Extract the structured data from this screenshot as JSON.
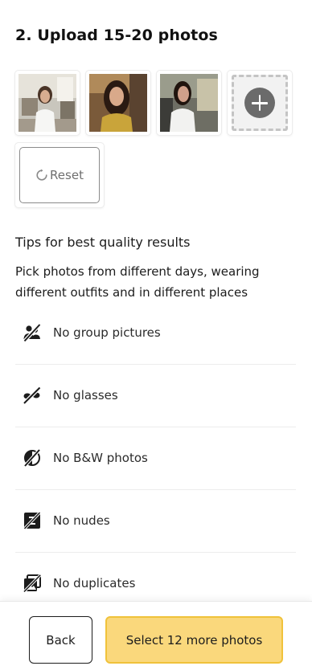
{
  "step": {
    "title": "2. Upload 15-20 photos"
  },
  "photos": [
    {
      "description": "woman in cafe",
      "icon": "photo-thumbnail"
    },
    {
      "description": "woman smiling with long hair",
      "icon": "photo-thumbnail"
    },
    {
      "description": "woman in white shirt",
      "icon": "photo-thumbnail"
    }
  ],
  "add_photo": {
    "icon": "plus-icon"
  },
  "reset": {
    "label": "Reset",
    "icon": "refresh-icon"
  },
  "tips": {
    "heading": "Tips for best quality results",
    "description": "Pick photos from different days, wearing different outfits and in different places",
    "rules": [
      {
        "label": "No group pictures",
        "icon": "no-group-icon"
      },
      {
        "label": "No glasses",
        "icon": "no-glasses-icon"
      },
      {
        "label": "No B&W photos",
        "icon": "no-bw-icon"
      },
      {
        "label": "No nudes",
        "icon": "no-nudes-icon"
      },
      {
        "label": "No duplicates",
        "icon": "no-duplicates-icon"
      }
    ]
  },
  "footer": {
    "back_label": "Back",
    "select_label": "Select 12 more photos"
  },
  "colors": {
    "primary_button_bg": "#fad87c",
    "primary_button_border": "#f0c23b"
  }
}
